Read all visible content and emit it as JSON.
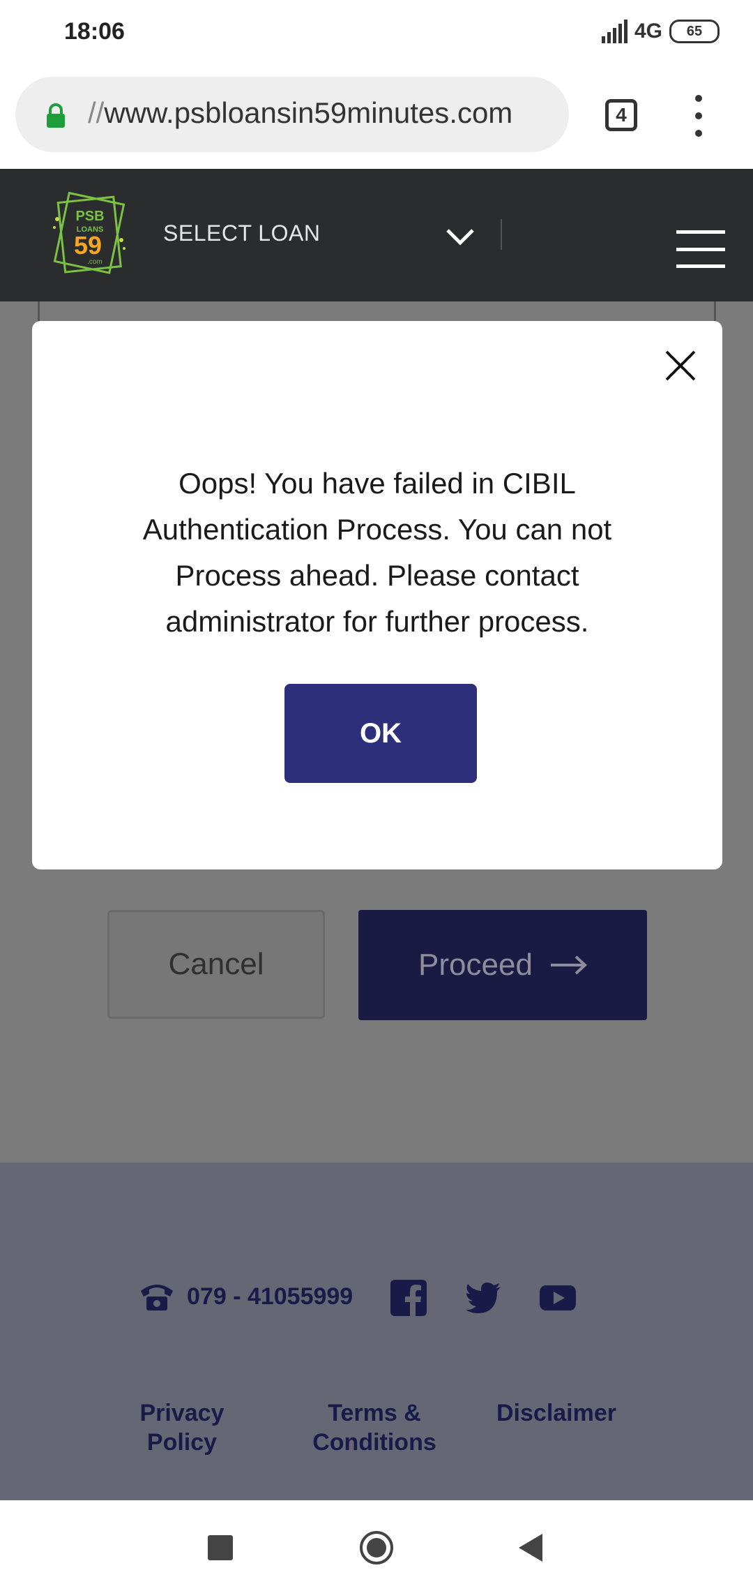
{
  "status_bar": {
    "time": "18:06",
    "network": "4G",
    "battery": "65"
  },
  "browser": {
    "url_prefix": "//",
    "url": "www.psbloansin59minutes.com",
    "tab_count": "4",
    "lock_color": "#1e9e3a"
  },
  "header": {
    "select_loan": "SELECT LOAN",
    "logo": {
      "line1": "PSB",
      "line2": "LOANS",
      "number": "59",
      "suffix": ".com"
    }
  },
  "page": {
    "cancel_label": "Cancel",
    "proceed_label": "Proceed"
  },
  "modal": {
    "message": "Oops! You have failed in CIBIL Authentication Process. You can not Process ahead. Please contact administrator for further process.",
    "ok_label": "OK",
    "ok_color": "#2e2f7a"
  },
  "footer": {
    "phone": "079 - 41055999",
    "social": [
      "facebook-icon",
      "twitter-icon",
      "youtube-icon"
    ],
    "links": [
      "Privacy Policy",
      "Terms & Conditions",
      "Disclaimer"
    ]
  },
  "nav_bar": {
    "buttons": [
      "recents-button",
      "home-button",
      "back-button"
    ]
  }
}
